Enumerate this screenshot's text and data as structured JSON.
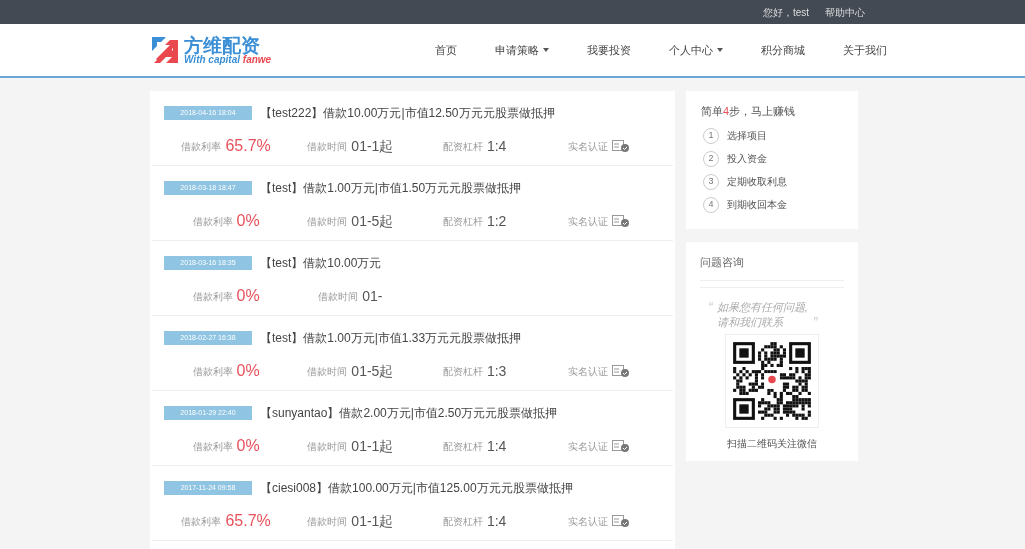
{
  "top_bar": {
    "greeting": "您好，test",
    "help": "帮助中心"
  },
  "logo": {
    "name": "方维配资",
    "tagline": [
      {
        "text": "With capital ",
        "highlight": false
      },
      {
        "text": "fanwe",
        "highlight": true
      }
    ]
  },
  "nav": [
    {
      "label": "首页",
      "dropdown": false
    },
    {
      "label": "申请策略",
      "dropdown": true
    },
    {
      "label": "我要投资",
      "dropdown": false
    },
    {
      "label": "个人中心",
      "dropdown": true
    },
    {
      "label": "积分商城",
      "dropdown": false
    },
    {
      "label": "关于我们",
      "dropdown": false
    }
  ],
  "loans": [
    {
      "date": "2018-04-16 18:04",
      "title": "【test222】借款10.00万元|市值12.50万元元股票做抵押",
      "meta": [
        {
          "kind": "rate",
          "label": "借款利率",
          "value": "65.7%"
        },
        {
          "kind": "plain",
          "label": "借款时间",
          "value": "01-1起"
        },
        {
          "kind": "plain",
          "label": "配资杠杆",
          "value": "1:4"
        },
        {
          "kind": "cert",
          "label": "实名认证"
        }
      ]
    },
    {
      "date": "2018-03-18 18:47",
      "title": "【test】借款1.00万元|市值1.50万元元股票做抵押",
      "meta": [
        {
          "kind": "rate",
          "label": "借款利率",
          "value": "0%"
        },
        {
          "kind": "plain",
          "label": "借款时间",
          "value": "01-5起"
        },
        {
          "kind": "plain",
          "label": "配资杠杆",
          "value": "1:2"
        },
        {
          "kind": "cert",
          "label": "实名认证"
        }
      ]
    },
    {
      "date": "2018-03-16 18:35",
      "title": "【test】借款10.00万元",
      "meta": [
        {
          "kind": "rate",
          "label": "借款利率",
          "value": "0%"
        },
        {
          "kind": "plain",
          "label": "借款时间",
          "value": "01-"
        }
      ]
    },
    {
      "date": "2018-02-27 16:38",
      "title": "【test】借款1.00万元|市值1.33万元元股票做抵押",
      "meta": [
        {
          "kind": "rate",
          "label": "借款利率",
          "value": "0%"
        },
        {
          "kind": "plain",
          "label": "借款时间",
          "value": "01-5起"
        },
        {
          "kind": "plain",
          "label": "配资杠杆",
          "value": "1:3"
        },
        {
          "kind": "cert",
          "label": "实名认证"
        }
      ]
    },
    {
      "date": "2018-01-29 22:40",
      "title": "【sunyantao】借款2.00万元|市值2.50万元元股票做抵押",
      "meta": [
        {
          "kind": "rate",
          "label": "借款利率",
          "value": "0%"
        },
        {
          "kind": "plain",
          "label": "借款时间",
          "value": "01-1起"
        },
        {
          "kind": "plain",
          "label": "配资杠杆",
          "value": "1:4"
        },
        {
          "kind": "cert",
          "label": "实名认证"
        }
      ]
    },
    {
      "date": "2017-11-24 09:58",
      "title": "【ciesi008】借款100.00万元|市值125.00万元元股票做抵押",
      "meta": [
        {
          "kind": "rate",
          "label": "借款利率",
          "value": "65.7%"
        },
        {
          "kind": "plain",
          "label": "借款时间",
          "value": "01-1起"
        },
        {
          "kind": "plain",
          "label": "配资杠杆",
          "value": "1:4"
        },
        {
          "kind": "cert",
          "label": "实名认证"
        }
      ]
    }
  ],
  "steps": {
    "heading": [
      {
        "text": "简单",
        "highlight": false
      },
      {
        "text": "4",
        "highlight": true
      },
      {
        "text": "步，马上赚钱",
        "highlight": false
      }
    ],
    "items": [
      {
        "number": "1",
        "label": "选择项目"
      },
      {
        "number": "2",
        "label": "投入资金"
      },
      {
        "number": "3",
        "label": "定期收取利息"
      },
      {
        "number": "4",
        "label": "到期收回本金"
      }
    ]
  },
  "consult": {
    "title": "问题咨询",
    "open_mark": "“",
    "quote": "如果您有任何问题,请和我们联系",
    "close_mark": "”",
    "qr_caption": "扫描二维码关注微信"
  }
}
